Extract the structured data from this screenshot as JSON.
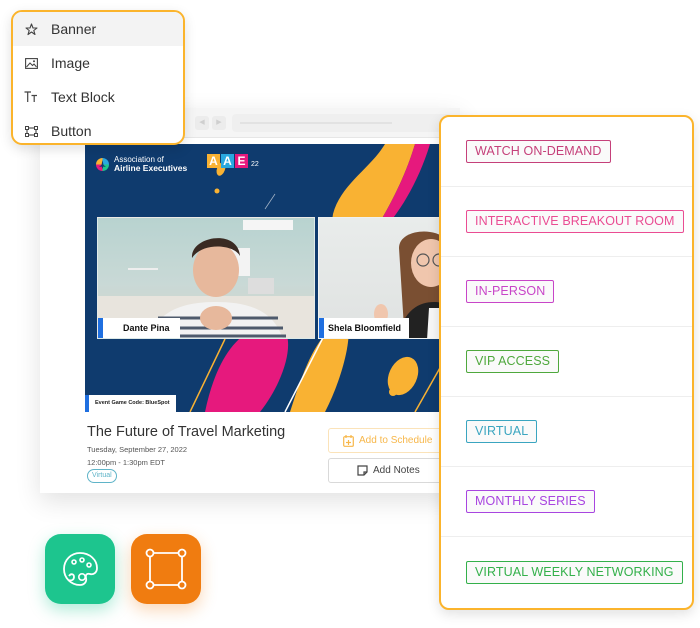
{
  "menu": {
    "items": [
      {
        "label": "Banner",
        "icon": "star-icon",
        "active": true
      },
      {
        "label": "Image",
        "icon": "image-icon",
        "active": false
      },
      {
        "label": "Text Block",
        "icon": "text-icon",
        "active": false
      },
      {
        "label": "Button",
        "icon": "button-frame-icon",
        "active": false
      }
    ]
  },
  "event": {
    "org_name_line1": "Association of",
    "org_name_line2": "Airline Executives",
    "brand_letters": [
      "A",
      "A",
      "E"
    ],
    "brand_letter_colors": [
      "#f9b233",
      "#2aa8e0",
      "#e6197d"
    ],
    "brand_year": "22",
    "speakers": [
      {
        "name": "Dante Pina"
      },
      {
        "name": "Shela Bloomfield"
      }
    ],
    "game_code": "Event Game Code: BlueSpot",
    "title": "The Future of Travel Marketing",
    "date": "Tuesday, September 27, 2022",
    "time": "12:00pm - 1:30pm EDT",
    "format_pill": "Virtual",
    "add_to_schedule_label": "Add to Schedule",
    "add_notes_label": "Add Notes"
  },
  "tags": [
    {
      "label": "WATCH ON-DEMAND",
      "color": "#c5407a"
    },
    {
      "label": "INTERACTIVE BREAKOUT ROOM",
      "color": "#ea4c93"
    },
    {
      "label": "IN-PERSON",
      "color": "#c845c8"
    },
    {
      "label": "VIP ACCESS",
      "color": "#4fa83d"
    },
    {
      "label": "VIRTUAL",
      "color": "#3aa5c0"
    },
    {
      "label": "MONTHLY SERIES",
      "color": "#a845e0"
    },
    {
      "label": "VIRTUAL WEEKLY NETWORKING",
      "color": "#33b04a"
    }
  ],
  "colors": {
    "accent_border": "#fbb42c",
    "banner_bg": "#0f3b6e",
    "palette_app": "#1dc58e",
    "frame_app": "#f07c10"
  },
  "apps": [
    {
      "name": "palette-app",
      "icon": "palette-icon"
    },
    {
      "name": "frame-app",
      "icon": "bounding-box-icon"
    }
  ]
}
